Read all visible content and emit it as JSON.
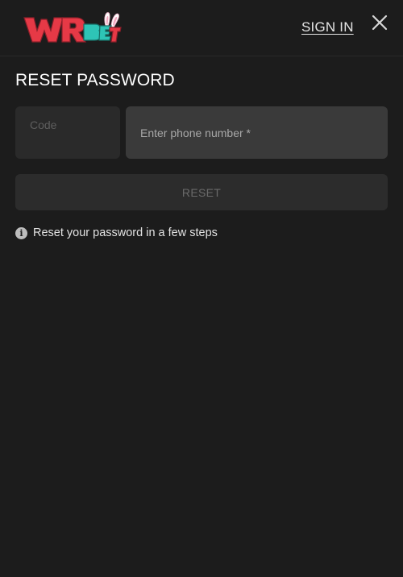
{
  "header": {
    "logo_text": "WRBET",
    "sign_in_label": "SIGN IN",
    "close_icon": "close-icon"
  },
  "form": {
    "title": "RESET PASSWORD",
    "code_label": "Code",
    "phone_placeholder": "Enter phone number *",
    "phone_value": "",
    "reset_label": "RESET"
  },
  "info": {
    "icon": "info-icon",
    "text": "Reset your password in a few steps"
  },
  "colors": {
    "background": "#1c1c1c",
    "field_bg": "#2a2a2a",
    "field_active_bg": "#3a3a3a",
    "logo_red": "#e63946",
    "logo_teal": "#2ec4b6"
  }
}
